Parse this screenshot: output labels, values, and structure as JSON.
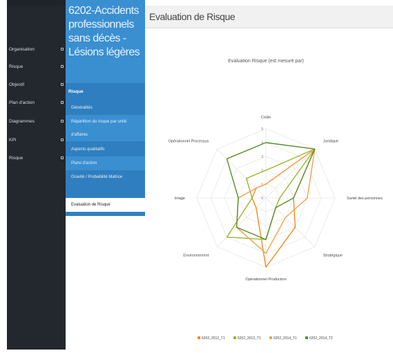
{
  "nav": {
    "items": [
      {
        "label": "Organisation"
      },
      {
        "label": "Risque"
      },
      {
        "label": "Objectif"
      },
      {
        "label": "Plan d'action"
      },
      {
        "label": "Diagrammes"
      },
      {
        "label": "KPI"
      },
      {
        "label": "Risque"
      }
    ]
  },
  "panel": {
    "title": "6202-Accidents professionnels sans décès - Lésions légères",
    "section": "Risque",
    "items": [
      {
        "label": "Généralités"
      },
      {
        "label": "Répartition du risque par unité"
      },
      {
        "label": "d'affaires"
      },
      {
        "label": "Aspects qualitatifs"
      },
      {
        "label": "Plans d'action"
      },
      {
        "label": "Gravité / Probabilité Matrice"
      },
      {
        "label": "Evaluation de Risque"
      }
    ]
  },
  "main": {
    "title": "Evaluation de Risque"
  },
  "colors": {
    "nav_bg": "#22282e",
    "panel_blue": "#3a8fd1",
    "panel_blue_dark": "#2f7fc0",
    "series": [
      "#f28a1e",
      "#9ab62a",
      "#f5a04a",
      "#5f8a2b"
    ]
  },
  "chart_data": {
    "type": "radar",
    "title": "Evaluation Risque (est mesuré par)",
    "axes": [
      "Coûts",
      "Juridique",
      "Santé des personnes",
      "Stratégique",
      "Opérationnel Production",
      "Environnement",
      "Image",
      "Opérationnel Processus"
    ],
    "rlim": [
      0,
      5
    ],
    "ticks": [
      "0",
      "1",
      "2",
      "3",
      "4",
      "5"
    ],
    "series": [
      {
        "name": "6202_2012_T1",
        "values": [
          1,
          5,
          2,
          3,
          5,
          1,
          1,
          1
        ]
      },
      {
        "name": "6202_2013_T1",
        "values": [
          2,
          5,
          1,
          1,
          3,
          4,
          1,
          2
        ]
      },
      {
        "name": "6202_2014_T1",
        "values": [
          1,
          5,
          3,
          2,
          4,
          3,
          2,
          1
        ]
      },
      {
        "name": "6202_2014_T2",
        "values": [
          4,
          5,
          2,
          1,
          3,
          3,
          2,
          4
        ]
      }
    ],
    "legend_position": "bottom"
  }
}
